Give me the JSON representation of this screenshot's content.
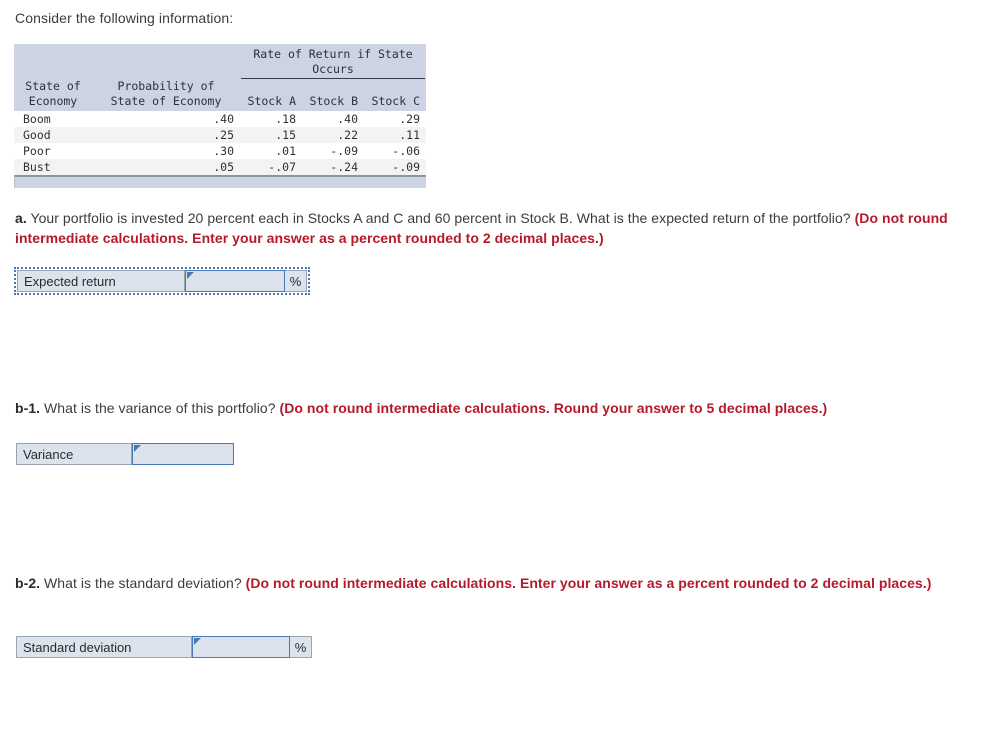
{
  "intro": "Consider the following information:",
  "table": {
    "span_header": "Rate of Return if State\nOccurs",
    "columns": [
      {
        "line1": "State of",
        "line2": "Economy"
      },
      {
        "line1": "Probability of",
        "line2": "State of Economy"
      },
      {
        "line1": "",
        "line2": "Stock A"
      },
      {
        "line1": "",
        "line2": "Stock B"
      },
      {
        "line1": "",
        "line2": "Stock C"
      }
    ],
    "rows": [
      {
        "state": "Boom",
        "probability": ".40",
        "stock_a": ".18",
        "stock_b": ".40",
        "stock_c": ".29"
      },
      {
        "state": "Good",
        "probability": ".25",
        "stock_a": ".15",
        "stock_b": ".22",
        "stock_c": ".11"
      },
      {
        "state": "Poor",
        "probability": ".30",
        "stock_a": ".01",
        "stock_b": "-.09",
        "stock_c": "-.06"
      },
      {
        "state": "Bust",
        "probability": ".05",
        "stock_a": "-.07",
        "stock_b": "-.24",
        "stock_c": "-.09"
      }
    ]
  },
  "questions": [
    {
      "id": "a",
      "marker": "a.",
      "prompt": " Your portfolio is invested 20 percent each in Stocks A and C and 60 percent in Stock B. What is the expected return of the portfolio? ",
      "hint": "(Do not round intermediate calculations. Enter your answer as a percent rounded to 2 decimal places.)",
      "answer": {
        "label": "Expected return",
        "value": "",
        "unit": "%"
      }
    },
    {
      "id": "b-1",
      "marker": "b-1.",
      "prompt": " What is the variance of this portfolio? ",
      "hint": "(Do not round intermediate calculations. Round your answer to 5 decimal places.)",
      "answer": {
        "label": "Variance",
        "value": "",
        "unit": ""
      }
    },
    {
      "id": "b-2",
      "marker": "b-2.",
      "prompt": " What is the standard deviation? ",
      "hint": "(Do not round intermediate calculations. Enter your answer as a percent rounded to 2 decimal places.)",
      "answer": {
        "label": "Standard deviation",
        "value": "",
        "unit": "%"
      }
    }
  ],
  "colors": {
    "header_bg": "#ccd3e2",
    "hint_red": "#b51a2b",
    "input_border": "#4a78b5",
    "input_bg": "#dbe2ec",
    "label_bg": "#dde3ec"
  }
}
